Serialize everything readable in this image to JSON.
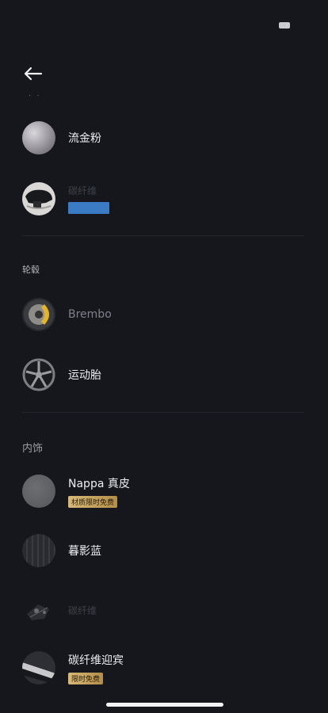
{
  "header": {
    "back_icon": "arrow-left-icon",
    "faded_text": "· ·"
  },
  "section_1": {
    "items": [
      {
        "label": "流金粉",
        "thumb": "swatch-rose-gold"
      },
      {
        "label": "碳纤维",
        "thumb": "carbon-mirror",
        "tag_color": "#3a7bc4"
      }
    ]
  },
  "section_2": {
    "title": "轮毂",
    "items": [
      {
        "label": "Brembo",
        "thumb": "brake-caliper-yellow"
      },
      {
        "label": "运动胎",
        "thumb": "wheel-rim"
      }
    ]
  },
  "section_3": {
    "title": "内饰",
    "items": [
      {
        "label": "Nappa 真皮",
        "badge": "材质限时免费",
        "thumb": "grey-leather"
      },
      {
        "label": "暮影蓝",
        "thumb": "dark-stripes"
      },
      {
        "label": "碳纤维",
        "thumb": "carbon-part"
      },
      {
        "label": "碳纤维迎宾",
        "badge": "限时免费",
        "thumb": "carbon-sill"
      }
    ]
  },
  "colors": {
    "background": "#15171c",
    "badge_gold": "#d8b978",
    "accent_blue": "#3a7bc4"
  }
}
